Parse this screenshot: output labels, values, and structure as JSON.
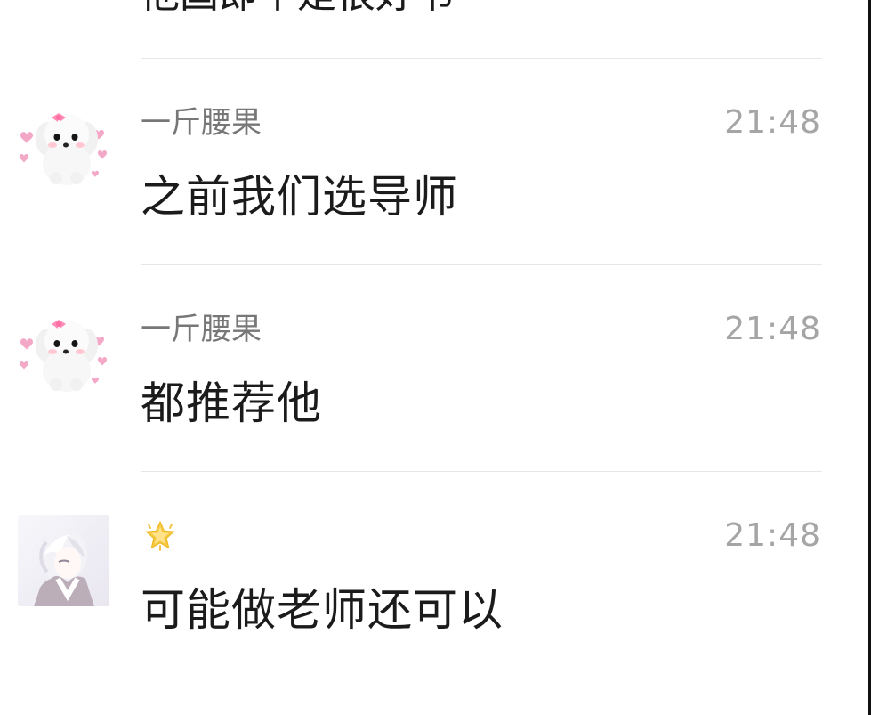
{
  "chat": {
    "cut_message": "他国即不是很好书",
    "messages": [
      {
        "avatar_icon": "white-puppy-avatar-icon",
        "sender": "一斤腰果",
        "time": "21:48",
        "text": "之前我们选导师"
      },
      {
        "avatar_icon": "white-puppy-avatar-icon",
        "sender": "一斤腰果",
        "time": "21:48",
        "text": "都推荐他"
      },
      {
        "avatar_icon": "anime-boy-avatar-icon",
        "sender_icon": "star-icon",
        "time": "21:48",
        "text": "可能做老师还可以"
      }
    ]
  },
  "colors": {
    "background": "#ffffff",
    "divider": "#e7e7e7",
    "message_text": "#1b1b1b",
    "sender_text": "#777777",
    "time_text": "#a5a5a5",
    "star": "#f5c842"
  }
}
